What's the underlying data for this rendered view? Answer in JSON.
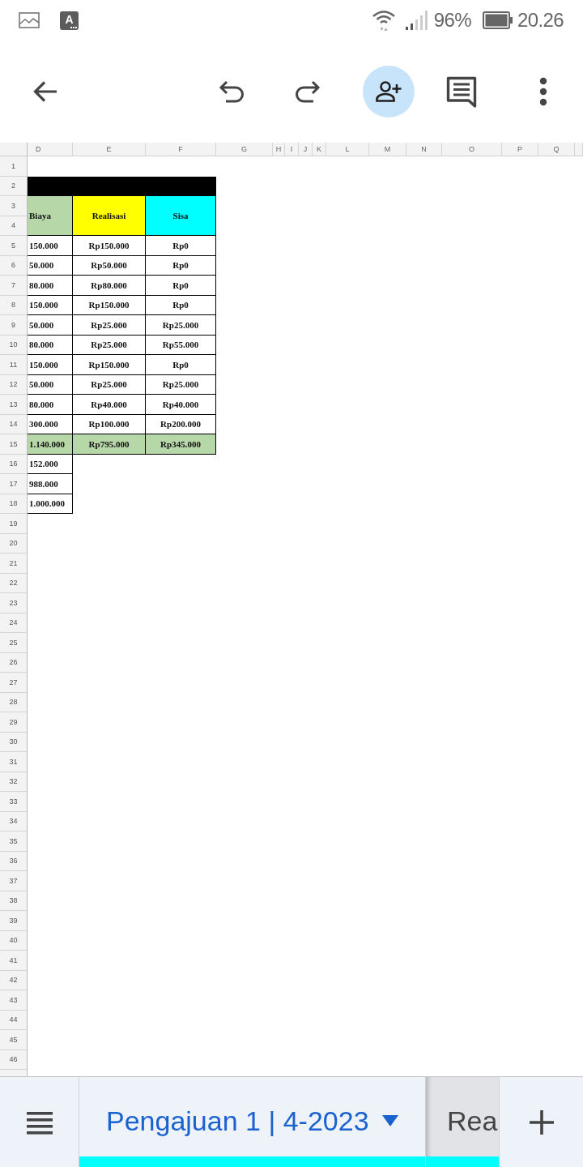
{
  "status_bar": {
    "notification_badge": "A",
    "battery_percent": "96%",
    "time": "20.26"
  },
  "sheet": {
    "columns": [
      "D",
      "E",
      "F",
      "G",
      "H",
      "I",
      "J",
      "K",
      "L",
      "M",
      "N",
      "O",
      "P",
      "Q"
    ],
    "row_numbers": [
      "1",
      "2",
      "3",
      "4",
      "5",
      "6",
      "7",
      "8",
      "9",
      "10",
      "11",
      "12",
      "13",
      "14",
      "15",
      "16",
      "17",
      "18",
      "19",
      "20",
      "21",
      "22",
      "23",
      "24",
      "25",
      "26",
      "27",
      "28",
      "29",
      "30",
      "31",
      "32",
      "33",
      "34",
      "35",
      "36",
      "37",
      "38",
      "39",
      "40",
      "41",
      "42",
      "43",
      "44",
      "45",
      "46"
    ]
  },
  "table": {
    "header": [
      {
        "text": "Biaya",
        "color": "#b6d7a8"
      },
      {
        "text": "Realisasi",
        "color": "#ffff00"
      },
      {
        "text": "Sisa",
        "color": "#00ffff"
      }
    ],
    "rows": [
      {
        "color": "#ffffff",
        "cells": [
          "150.000",
          "Rp150.000",
          "Rp0"
        ]
      },
      {
        "color": "#ffffff",
        "cells": [
          "50.000",
          "Rp50.000",
          "Rp0"
        ]
      },
      {
        "color": "#ffffff",
        "cells": [
          "80.000",
          "Rp80.000",
          "Rp0"
        ]
      },
      {
        "color": "#ffffff",
        "cells": [
          "150.000",
          "Rp150.000",
          "Rp0"
        ]
      },
      {
        "color": "#ffffff",
        "cells": [
          "50.000",
          "Rp25.000",
          "Rp25.000"
        ]
      },
      {
        "color": "#ffffff",
        "cells": [
          "80.000",
          "Rp25.000",
          "Rp55.000"
        ]
      },
      {
        "color": "#ffffff",
        "cells": [
          "150.000",
          "Rp150.000",
          "Rp0"
        ]
      },
      {
        "color": "#ffffff",
        "cells": [
          "50.000",
          "Rp25.000",
          "Rp25.000"
        ]
      },
      {
        "color": "#ffffff",
        "cells": [
          "80.000",
          "Rp40.000",
          "Rp40.000"
        ]
      },
      {
        "color": "#ffffff",
        "cells": [
          "300.000",
          "Rp100.000",
          "Rp200.000"
        ]
      },
      {
        "color": "#b6d7a8",
        "cells": [
          "1.140.000",
          "Rp795.000",
          "Rp345.000"
        ]
      },
      {
        "color": "#ffffff",
        "cells": [
          "152.000"
        ]
      },
      {
        "color": "#ffffff",
        "cells": [
          "988.000"
        ]
      },
      {
        "color": "#ffffff",
        "cells": [
          "1.000.000"
        ]
      }
    ]
  },
  "sheet_tabs": [
    {
      "label": "Pengajuan 1 | 4-2023",
      "selected": true,
      "color": "#00ffff"
    },
    {
      "label": "Rea",
      "selected": false,
      "color": "#00ffff"
    }
  ]
}
